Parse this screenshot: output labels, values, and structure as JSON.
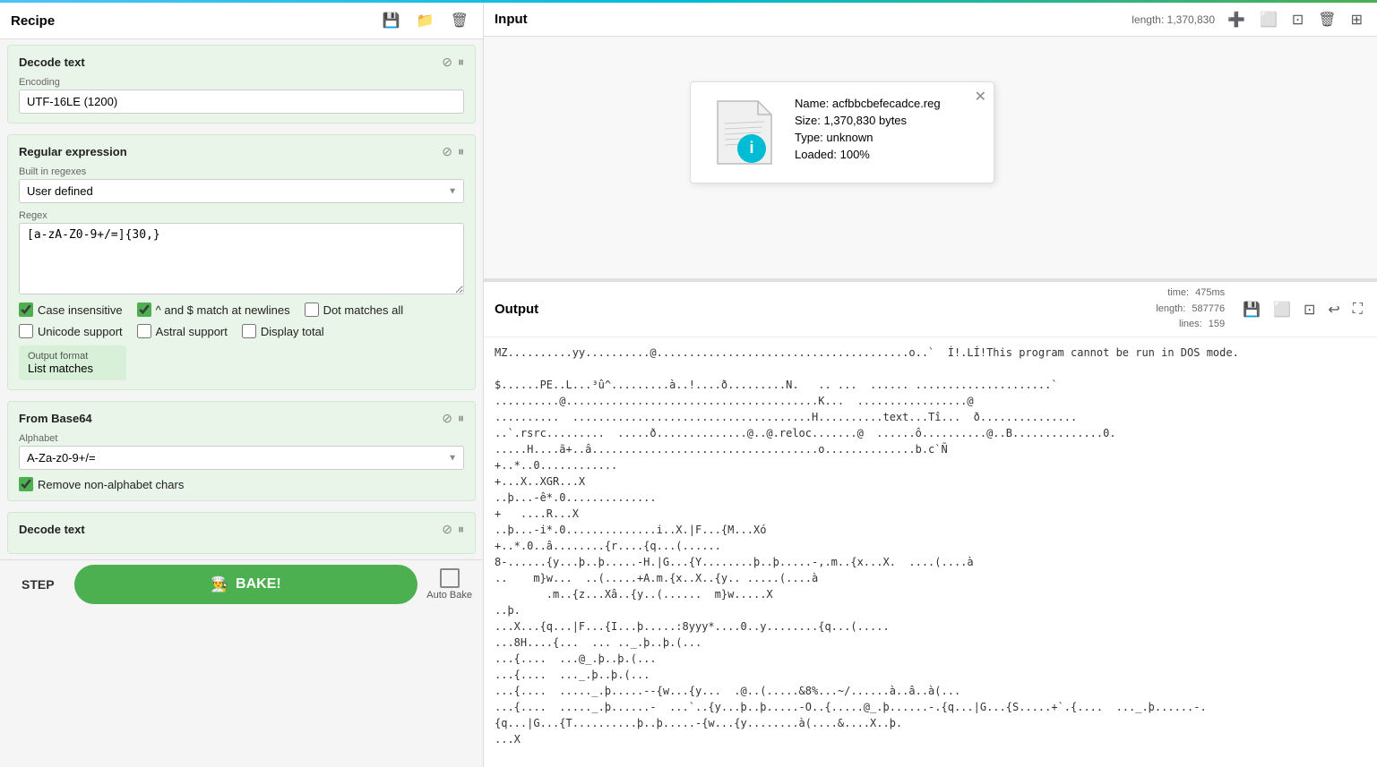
{
  "top_accent": true,
  "left_panel": {
    "recipe_title": "Recipe",
    "icons": {
      "save": "💾",
      "folder": "📁",
      "trash": "🗑"
    },
    "decode_text_section": {
      "title": "Decode text",
      "encoding_label": "Encoding",
      "encoding_value": "UTF-16LE (1200)"
    },
    "regex_section": {
      "title": "Regular expression",
      "built_in_label": "Built in regexes",
      "built_in_value": "User defined",
      "regex_label": "Regex",
      "regex_value": "[a-zA-Z0-9+/=]{30,}"
    },
    "checkboxes": {
      "case_insensitive": {
        "label": "Case insensitive",
        "checked": true
      },
      "caret_dollar": {
        "label": "^ and $ match at newlines",
        "checked": true
      },
      "dot_matches_all": {
        "label": "Dot matches all",
        "checked": false
      },
      "unicode_support": {
        "label": "Unicode support",
        "checked": false
      },
      "astral_support": {
        "label": "Astral support",
        "checked": false
      },
      "display_total": {
        "label": "Display total",
        "checked": false
      }
    },
    "output_format": {
      "label": "Output format",
      "value": "List matches"
    },
    "from_base64_section": {
      "title": "From Base64",
      "alphabet_label": "Alphabet",
      "alphabet_value": "A-Za-z0-9+/=",
      "remove_label": "Remove non-alphabet chars",
      "remove_checked": true
    },
    "decode_text2_section": {
      "title": "Decode text"
    },
    "bottom": {
      "step_label": "STEP",
      "bake_label": "BAKE!",
      "auto_bake_label": "Auto Bake"
    }
  },
  "input_panel": {
    "title": "Input",
    "meta": "length: 1,370,830",
    "file_card": {
      "name_label": "Name: acfbbcbefecadce.reg",
      "size_label": "Size: 1,370,830 bytes",
      "type_label": "Type: unknown",
      "loaded_label": "Loaded: 100%"
    }
  },
  "output_panel": {
    "title": "Output",
    "time_label": "time:",
    "time_value": "475ms",
    "length_label": "length:",
    "length_value": "587776",
    "lines_label": "lines:",
    "lines_value": "159",
    "content": "MZ..........yy..........@.......................................o..`  Í!.LÍ!This program cannot be run in DOS mode.\n\n$......PE..L...³û^.........à..!....ð.........N.   .. ...  ...... .....................`\n..........@.......................................K...  .................@\n..........  .....................................H..........text...Tî...  ð...............\n..`.rsrc.........  .....ð..............@..@.reloc.......@  ......ô..........@..B..............0.\n.....H....ã+..â...................................o..............b.c`Ñ\n+..*..0............\n+...X..XGR...X\n..þ...-ê*.0..............\n+   ....R...X\n..þ...-i*.0..............i..X.|F...{M...Xó\n+..*.0..â........{r....{q...(......\n8-......{y...þ..þ.....-H.|G...{Y........þ..þ.....-,.m..{x...X.  ....(....à\n..    m}w...  ..(.....+A.m.{x..X..{y.. .....(....à\n        .m..{z...Xâ..{y..(......  m}w.....X\n..þ.\n...X...{q...|F...{I...þ.....:8yyy*....0..y........{q...(.....\n...8H....{...  ... .._.þ..þ.(...\n...{....  ...@_.þ..þ.(...\n...{....  ..._.þ..þ.(...\n...{....  ....._.þ.....--{w...{y...  .@..(.....&8%...~/......à..â..à(...\n...{....  ....._.þ......-  ...`..{y...þ..þ.....-O..{.....@_.þ......-.{q...|G...{S.....+`.{....  ..._.þ......-.\n{q...|G...{T..........þ..þ.....-{w...{y........à(....&....X..þ.\n...X"
  }
}
